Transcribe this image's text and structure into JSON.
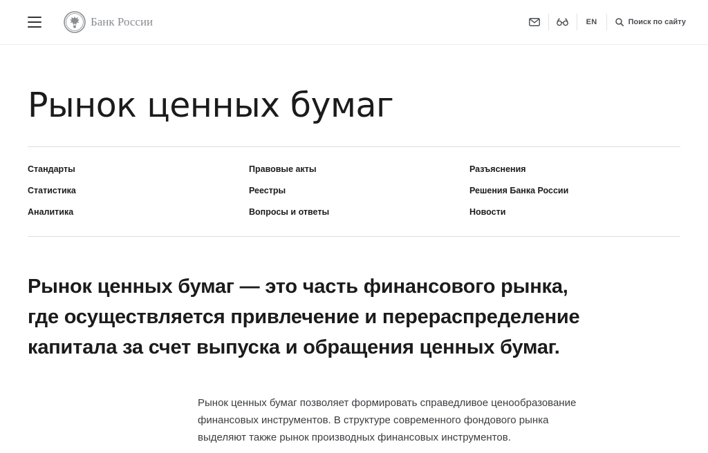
{
  "header": {
    "logo_text": "Банк России",
    "lang_label": "EN",
    "search_label": "Поиск по сайту",
    "icons": {
      "menu": "hamburger-menu-icon",
      "emblem": "double-headed-eagle-emblem-icon",
      "mail": "envelope-icon",
      "accessibility": "glasses-icon",
      "search": "magnifier-icon"
    }
  },
  "page": {
    "title": "Рынок ценных бумаг"
  },
  "nav": {
    "items": [
      {
        "label": "Стандарты"
      },
      {
        "label": "Статистика"
      },
      {
        "label": "Аналитика"
      },
      {
        "label": "Правовые акты"
      },
      {
        "label": "Реестры"
      },
      {
        "label": "Вопросы и ответы"
      },
      {
        "label": "Разъяснения"
      },
      {
        "label": "Решения Банка России"
      },
      {
        "label": "Новости"
      }
    ]
  },
  "lead": {
    "lines": [
      "Рынок ценных бумаг — это часть финансового рынка,",
      "где осуществляется привлечение и перераспределение",
      "капитала за счет выпуска и обращения ценных бумаг."
    ]
  },
  "body": {
    "lines": [
      "Рынок ценных бумаг позволяет формировать справедливое ценообразование",
      "финансовых инструментов. В структуре современного фондового рынка",
      "выделяют также рынок производных финансовых инструментов."
    ]
  },
  "colors": {
    "text": "#1b1b1b",
    "muted": "#8a8d92",
    "divider": "#dedede"
  }
}
